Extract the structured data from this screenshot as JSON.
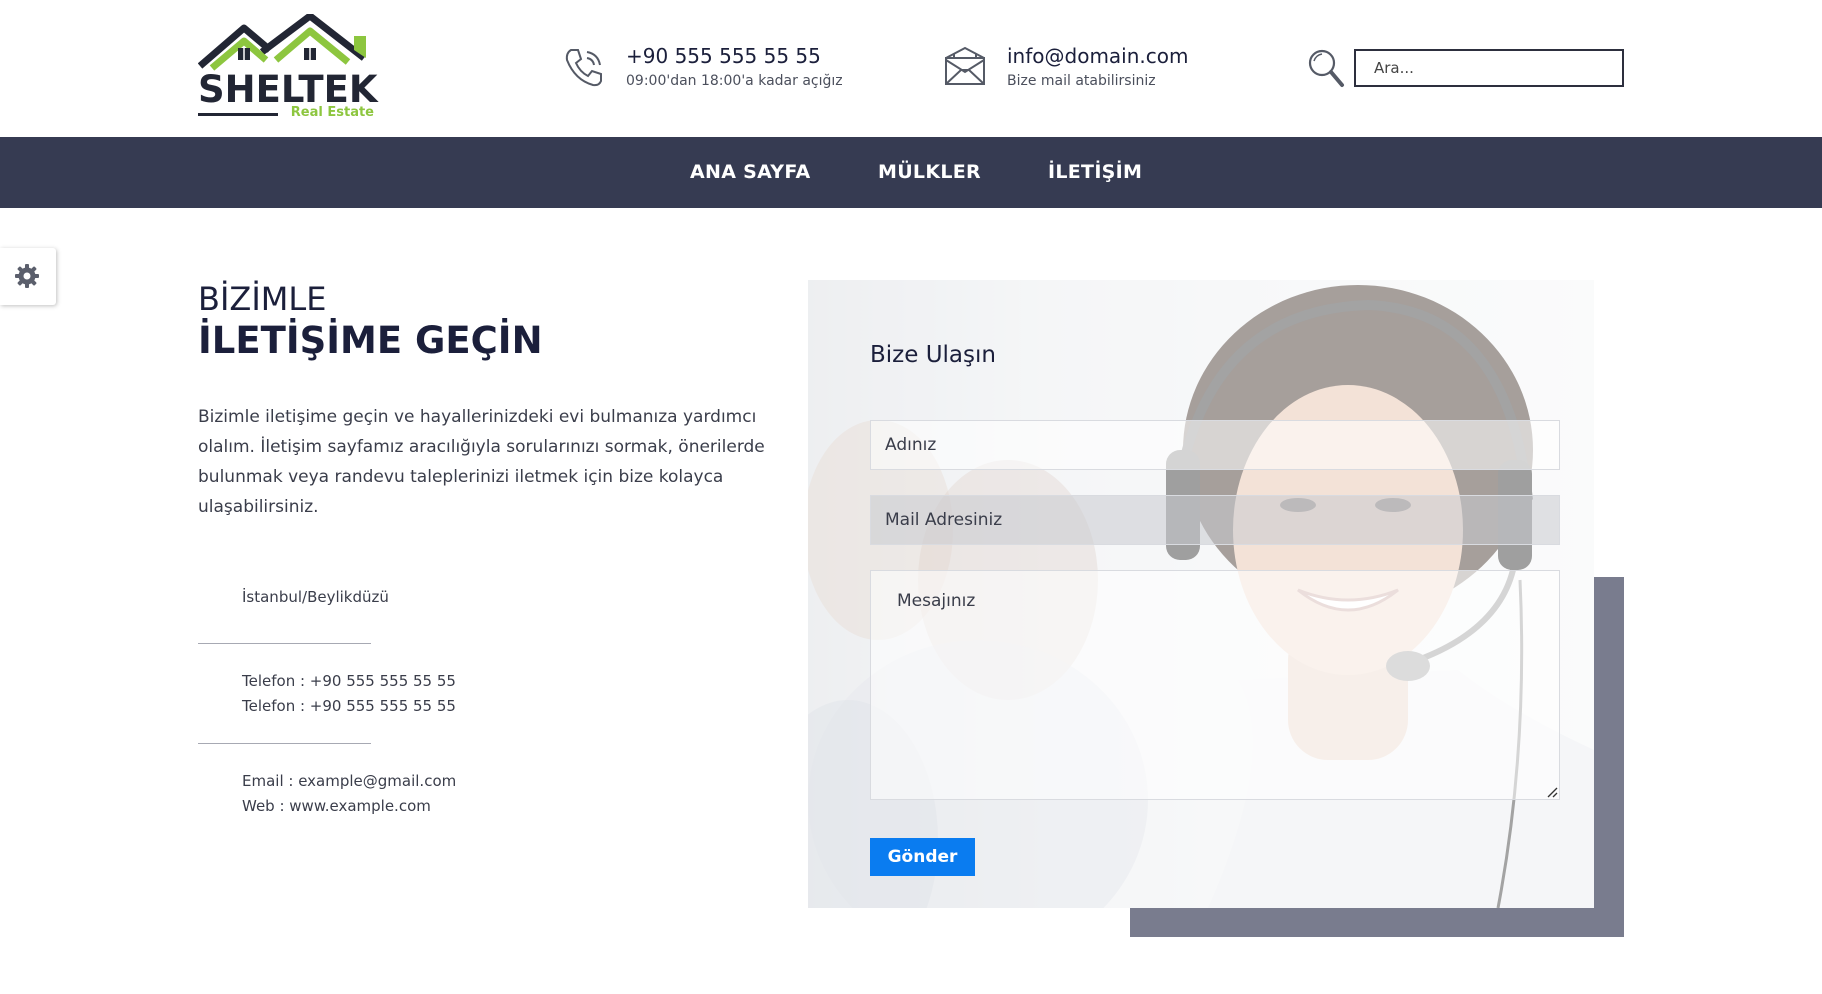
{
  "header": {
    "logo": {
      "brand": "SHELTEK",
      "tagline": "Real Estate",
      "icon": "house-roof-logo"
    },
    "phone": {
      "icon": "phone-icon",
      "number": "+90 555 555 55 55",
      "hours": "09:00'dan 18:00'a kadar açığız"
    },
    "mail": {
      "icon": "envelope-icon",
      "address": "info@domain.com",
      "note": "Bize mail atabilirsiniz"
    },
    "search": {
      "icon": "search-icon",
      "placeholder": "Ara..."
    }
  },
  "nav": {
    "items": [
      {
        "label": "ANA SAYFA"
      },
      {
        "label": "MÜLKLER"
      },
      {
        "label": "İLETİŞİM"
      }
    ]
  },
  "settings": {
    "icon": "gear-icon"
  },
  "main": {
    "headline_top": "BİZİMLE",
    "headline_bottom": "İLETİŞİME GEÇİN",
    "intro": "Bizimle iletişime geçin ve hayallerinizdeki evi bulmanıza yardımcı olalım. İletişim sayfamız aracılığıyla sorularınızı sormak, önerilerde bulunmak veya randevu taleplerinizi iletmek için bize kolayca ulaşabilirsiniz.",
    "address": "İstanbul/Beylikdüzü",
    "phones": [
      "Telefon : +90 555 555 55 55",
      "Telefon : +90 555 555 55 55"
    ],
    "email": "Email : example@gmail.com",
    "web": "Web : www.example.com"
  },
  "form": {
    "title": "Bize Ulaşın",
    "name_placeholder": "Adınız",
    "email_placeholder": "Mail Adresiniz",
    "message_placeholder": "Mesajınız",
    "submit_label": "Gönder"
  },
  "colors": {
    "nav_bg": "#363b52",
    "accent_green": "#8dc63f",
    "button_blue": "#0a7cf0",
    "shadow_block": "#797c8e",
    "text_dark": "#1b1f3b"
  }
}
